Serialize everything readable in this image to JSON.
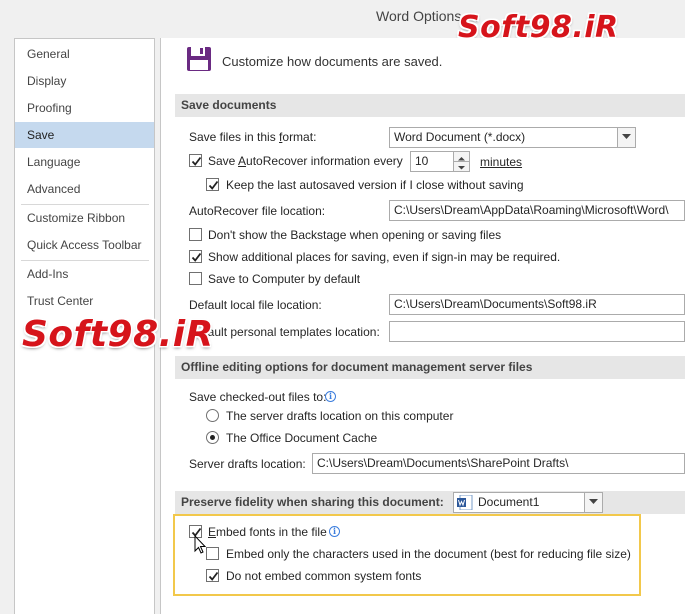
{
  "window": {
    "title": "Word Options"
  },
  "watermark": {
    "text": "Soft98.iR"
  },
  "sidebar": {
    "items": [
      {
        "label": "General"
      },
      {
        "label": "Display"
      },
      {
        "label": "Proofing"
      },
      {
        "label": "Save"
      },
      {
        "label": "Language"
      },
      {
        "label": "Advanced"
      },
      {
        "label": "Customize Ribbon"
      },
      {
        "label": "Quick Access Toolbar"
      },
      {
        "label": "Add-Ins"
      },
      {
        "label": "Trust Center"
      }
    ],
    "active": "Save"
  },
  "header": {
    "text": "Customize how documents are saved."
  },
  "save_documents": {
    "heading": "Save documents",
    "format_label": "Save files in this format:",
    "format_value": "Word Document (*.docx)",
    "autorecover_label": "Save AutoRecover information every",
    "autorecover_minutes": "10",
    "minutes_label": "minutes",
    "keep_last_label": "Keep the last autosaved version if I close without saving",
    "autorecover_location_label": "AutoRecover file location:",
    "autorecover_location_value": "C:\\Users\\Dream\\AppData\\Roaming\\Microsoft\\Word\\",
    "dont_show_backstage_label": "Don't show the Backstage when opening or saving files",
    "show_additional_label": "Show additional places for saving, even if sign-in may be required.",
    "save_to_computer_label": "Save to Computer by default",
    "default_local_label": "Default local file location:",
    "default_local_value": "C:\\Users\\Dream\\Documents\\Soft98.iR",
    "default_templates_label": "Default personal templates location:",
    "default_templates_value": ""
  },
  "offline": {
    "heading": "Offline editing options for document management server files",
    "checked_out_label": "Save checked-out files to:",
    "server_drafts_option": "The server drafts location on this computer",
    "office_cache_option": "The Office Document Cache",
    "server_drafts_location_label": "Server drafts location:",
    "server_drafts_location_value": "C:\\Users\\Dream\\Documents\\SharePoint Drafts\\"
  },
  "fidelity": {
    "heading": "Preserve fidelity when sharing this document:",
    "document_value": "Document1",
    "embed_fonts_label": "Embed fonts in the file",
    "embed_only_label": "Embed only the characters used in the document (best for reducing file size)",
    "do_not_embed_label": "Do not embed common system fonts"
  },
  "state": {
    "autorecover_checked": true,
    "keep_last_checked": true,
    "dont_show_backstage_checked": false,
    "show_additional_checked": true,
    "save_to_computer_checked": false,
    "radio_selected": "The Office Document Cache",
    "embed_fonts_checked": true,
    "embed_only_checked": false,
    "do_not_embed_checked": true
  },
  "colors": {
    "accent_selection": "#c5d9ee",
    "highlight_border": "#f2c84b",
    "watermark": "#d6141b",
    "section_bg": "#e6e6e6"
  }
}
